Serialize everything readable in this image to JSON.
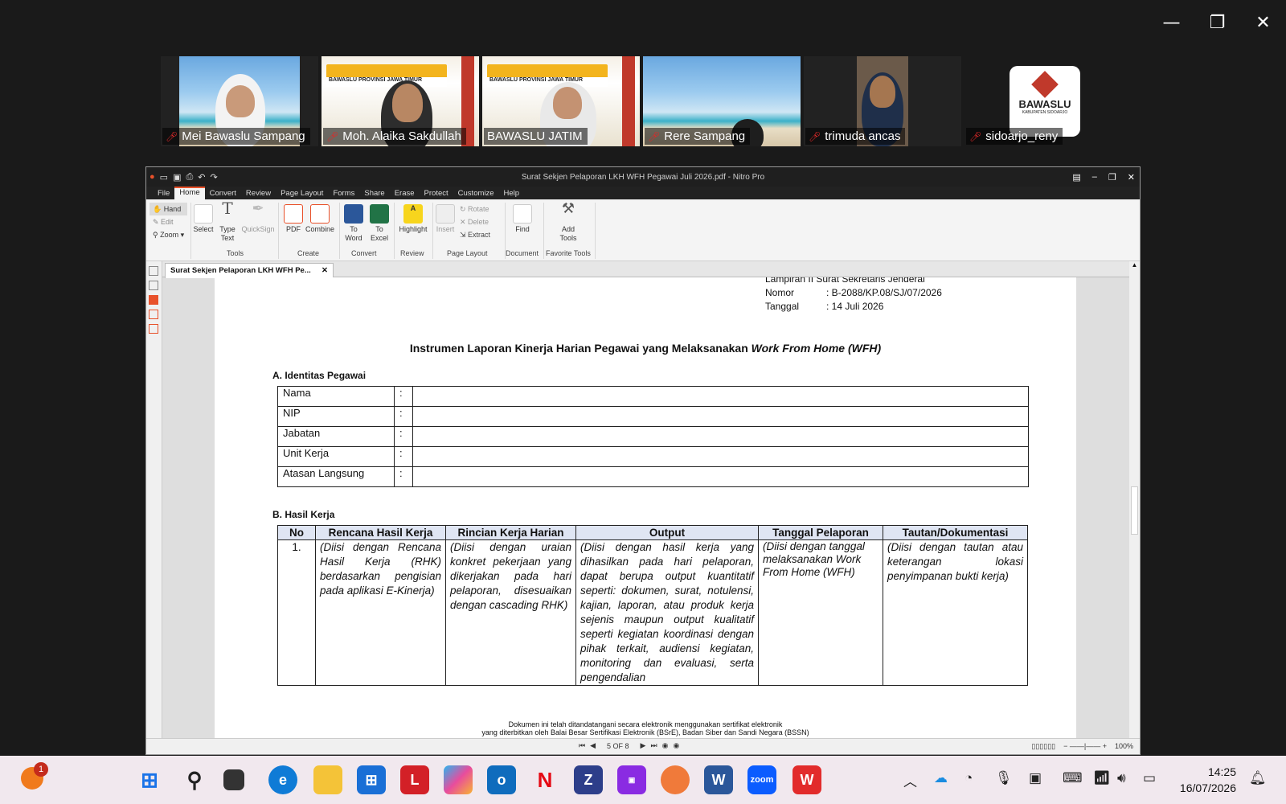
{
  "window_controls": {
    "minimize": "—",
    "restore": "❐",
    "close": "✕"
  },
  "participants": [
    {
      "name": "Mei Bawaslu Sampang",
      "muted": true
    },
    {
      "name": "Moh. Alaika Sakdullah",
      "muted": true
    },
    {
      "name": "BAWASLU JATIM",
      "muted": false
    },
    {
      "name": "Rere Sampang",
      "muted": true
    },
    {
      "name": "trimuda ancas",
      "muted": true
    },
    {
      "name": "sidoarjo_reny",
      "muted": true
    }
  ],
  "banner_text": "ORIENTASI PPPK",
  "banner_sub": "BAWASLU PROVINSI JAWA TIMUR",
  "logo_text": "BAWASLU",
  "logo_sub": "KABUPATEN SIDOARJO",
  "nitro": {
    "title": "Surat Sekjen Pelaporan LKH WFH Pegawai Juli 2026.pdf - Nitro Pro",
    "menu": [
      "File",
      "Home",
      "Convert",
      "Review",
      "Page Layout",
      "Forms",
      "Share",
      "Erase",
      "Protect",
      "Customize",
      "Help"
    ],
    "ribbon": {
      "hand": "Hand",
      "edit": "Edit",
      "zoom": "Zoom",
      "select": "Select",
      "type_text": "Type Text",
      "quicksign": "QuickSign",
      "pdf": "PDF",
      "combine": "Combine",
      "to_word": "To Word",
      "to_excel": "To Excel",
      "highlight": "Highlight",
      "insert": "Insert",
      "rotate": "Rotate",
      "delete": "Delete",
      "extract": "Extract",
      "find": "Find",
      "add_tools": "Add Tools",
      "groups": {
        "tools": "Tools",
        "create": "Create",
        "convert": "Convert",
        "review": "Review",
        "page_layout": "Page Layout",
        "document": "Document",
        "favorite": "Favorite Tools"
      }
    },
    "tab_label": "Surat Sekjen Pelaporan LKH WFH Pe...",
    "page_nav": "5 OF 8",
    "zoom": "100%"
  },
  "doc": {
    "lampiran": "Lampiran II Surat Sekretaris Jenderal",
    "nomor_label": "Nomor",
    "nomor_value": ": B-2088/KP.08/SJ/07/2026",
    "tanggal_label": "Tanggal",
    "tanggal_value": ": 14 Juli 2026",
    "title_plain": "Instrumen Laporan Kinerja Harian Pegawai yang Melaksanakan ",
    "title_italic": "Work From Home (WFH)",
    "section_a": "A. Identitas Pegawai",
    "identity_fields": [
      "Nama",
      "NIP",
      "Jabatan",
      "Unit Kerja",
      "Atasan Langsung"
    ],
    "colon": ":",
    "section_b": "B. Hasil Kerja",
    "headers": [
      "No",
      "Rencana Hasil Kerja",
      "Rincian Kerja Harian",
      "Output",
      "Tanggal Pelaporan",
      "Tautan/Dokumentasi"
    ],
    "row": {
      "no": "1.",
      "rhk": "(Diisi dengan Rencana Hasil Kerja (RHK) berdasarkan pengisian pada aplikasi E-Kinerja)",
      "rincian": "(Diisi dengan uraian konkret pekerjaan yang dikerjakan pada hari pelaporan, disesuaikan dengan cascading RHK)",
      "output": "(Diisi dengan hasil kerja yang dihasilkan pada hari pelaporan, dapat berupa output kuantitatif seperti: dokumen, surat, notulensi, kajian, laporan, atau produk kerja sejenis maupun output kualitatif seperti kegiatan koordinasi dengan pihak terkait, audiensi kegiatan, monitoring dan evaluasi, serta pengendalian",
      "tanggal": "(Diisi dengan tanggal melaksanakan Work From Home (WFH)",
      "tautan": "(Diisi dengan tautan atau keterangan lokasi penyimpanan bukti kerja)"
    },
    "footer1": "Dokumen ini telah ditandatangani secara elektronik menggunakan sertifikat elektronik",
    "footer2": "yang diterbitkan oleh Balai Besar Sertifikasi Elektronik (BSrE), Badan Siber dan Sandi Negara (BSSN)"
  },
  "taskbar": {
    "notification_count": "1",
    "time": "14:25",
    "date": "16/07/2026"
  }
}
